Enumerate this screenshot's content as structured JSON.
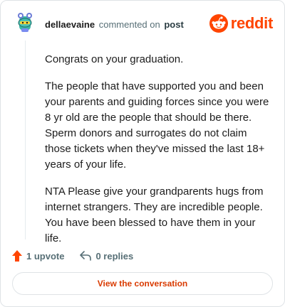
{
  "header": {
    "username": "dellaevaine",
    "action_text": "commented on",
    "target_text": "post",
    "brand_name": "reddit"
  },
  "comment": {
    "paragraphs": [
      "Congrats on your graduation.",
      "The people that have supported you and been your parents and guiding forces since you were 8 yr old are the people that should be there. Sperm donors and surrogates do not claim those tickets when they've missed the last 18+ years of your life.",
      "NTA Please give your grandparents hugs from internet strangers. They are incredible people. You have been blessed to have them in your life."
    ]
  },
  "actions": {
    "upvote_label": "1 upvote",
    "replies_label": "0 replies"
  },
  "cta": {
    "label": "View the conversation"
  },
  "colors": {
    "brand": "#ff4500",
    "cta_text": "#d93a00",
    "muted": "#576f76"
  },
  "icons": [
    "avatar",
    "reddit-logo-icon",
    "upvote-arrow-icon",
    "reply-arrow-icon"
  ]
}
